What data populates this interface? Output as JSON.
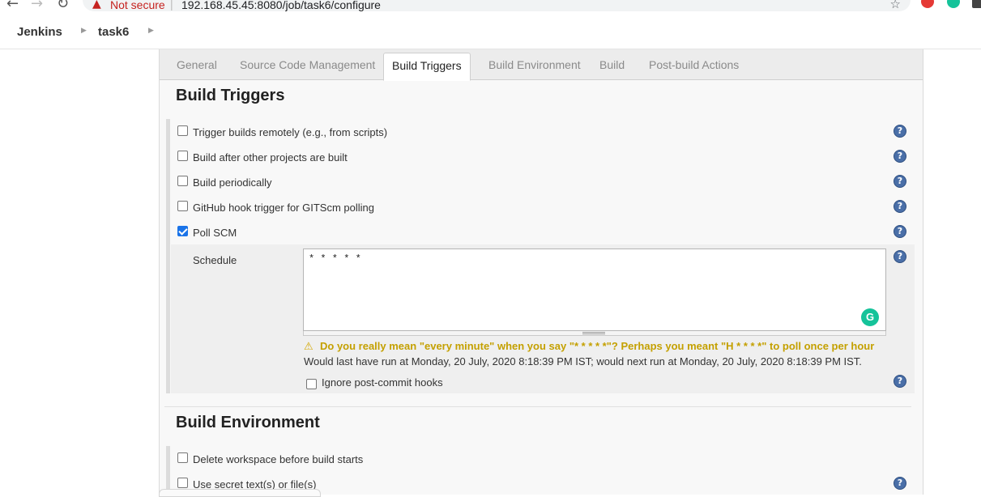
{
  "browser": {
    "security_warning": "Not secure",
    "url": "192.168.45.45:8080/job/task6/configure"
  },
  "breadcrumb": [
    "Jenkins",
    "task6"
  ],
  "tabs": [
    {
      "label": "General",
      "active": false
    },
    {
      "label": "Source Code Management",
      "active": false
    },
    {
      "label": "Build Triggers",
      "active": true
    },
    {
      "label": "Build Environment",
      "active": false
    },
    {
      "label": "Build",
      "active": false
    },
    {
      "label": "Post-build Actions",
      "active": false
    }
  ],
  "build_triggers": {
    "title": "Build Triggers",
    "options": [
      {
        "label": "Trigger builds remotely (e.g., from scripts)",
        "checked": false
      },
      {
        "label": "Build after other projects are built",
        "checked": false
      },
      {
        "label": "Build periodically",
        "checked": false
      },
      {
        "label": "GitHub hook trigger for GITScm polling",
        "checked": false
      },
      {
        "label": "Poll SCM",
        "checked": true
      }
    ],
    "schedule": {
      "label": "Schedule",
      "value": "* * * * *",
      "warning": "Do you really mean \"every minute\" when you say \"* * * * *\"? Perhaps you meant \"H * * * *\" to poll once per hour",
      "info": "Would last have run at Monday, 20 July, 2020 8:18:39 PM IST; would next run at Monday, 20 July, 2020 8:18:39 PM IST.",
      "ignore_hooks_label": "Ignore post-commit hooks",
      "ignore_hooks_checked": false
    }
  },
  "build_environment": {
    "title": "Build Environment",
    "options": [
      {
        "label": "Delete workspace before build starts",
        "checked": false
      },
      {
        "label": "Use secret text(s) or file(s)",
        "checked": false
      }
    ]
  },
  "help_symbol": "?",
  "colors": {
    "warning": "#c4a000",
    "checkbox_checked": "#1a73e8",
    "help_icon": "#4a6fa8"
  }
}
